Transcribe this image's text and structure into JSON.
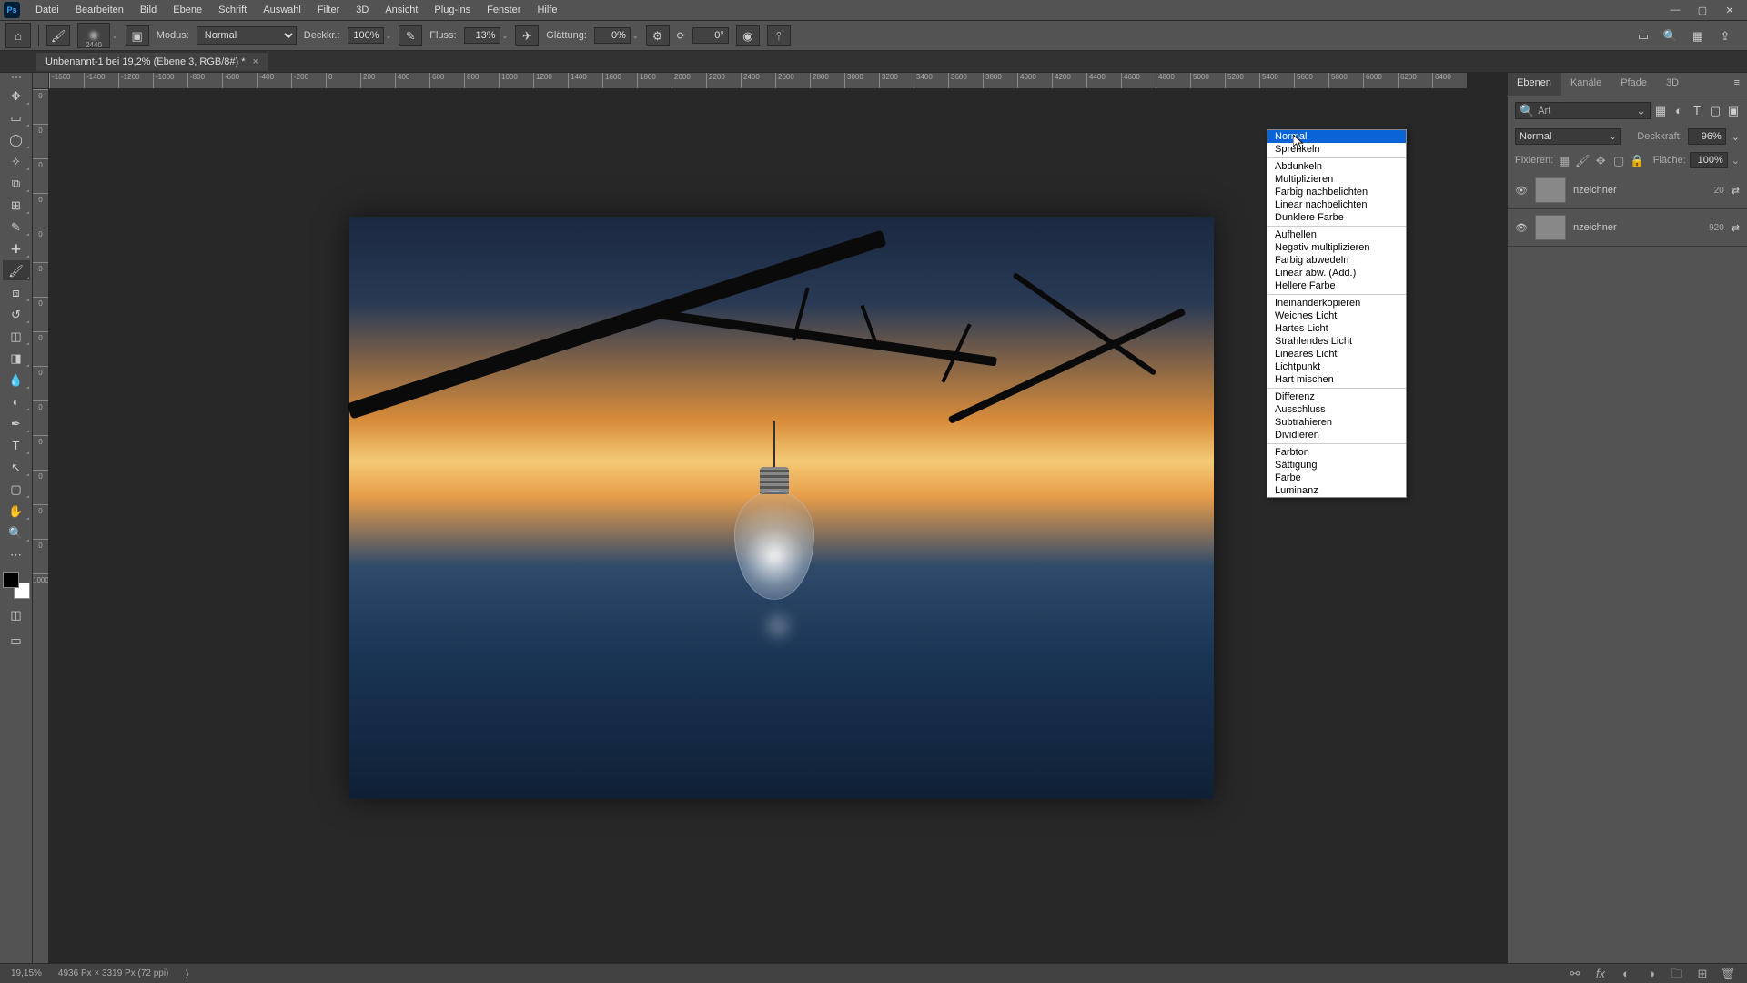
{
  "app": {
    "ps_badge": "Ps"
  },
  "menubar": [
    "Datei",
    "Bearbeiten",
    "Bild",
    "Ebene",
    "Schrift",
    "Auswahl",
    "Filter",
    "3D",
    "Ansicht",
    "Plug-ins",
    "Fenster",
    "Hilfe"
  ],
  "options": {
    "brush_size": "2440",
    "modus_label": "Modus:",
    "modus_value": "Normal",
    "deckkr_label": "Deckkr.:",
    "deckkr_value": "100%",
    "fluss_label": "Fluss:",
    "fluss_value": "13%",
    "glaettung_label": "Glättung:",
    "glaettung_value": "0%",
    "angle_label": "⟳",
    "angle_value": "0°"
  },
  "doc_tab": {
    "title": "Unbenannt-1 bei 19,2% (Ebene 3, RGB/8#) *"
  },
  "ruler_h": [
    "-1600",
    "-1400",
    "-1200",
    "-1000",
    "-800",
    "-600",
    "-400",
    "-200",
    "0",
    "200",
    "400",
    "600",
    "800",
    "1000",
    "1200",
    "1400",
    "1600",
    "1800",
    "2000",
    "2200",
    "2400",
    "2600",
    "2800",
    "3000",
    "3200",
    "3400",
    "3600",
    "3800",
    "4000",
    "4200",
    "4400",
    "4600",
    "4800",
    "5000",
    "5200",
    "5400",
    "5600",
    "5800",
    "6000",
    "6200",
    "6400"
  ],
  "ruler_v": [
    "0",
    "0",
    "0",
    "0",
    "0",
    "0",
    "0",
    "0",
    "0",
    "0",
    "0",
    "0",
    "0",
    "0",
    "1000"
  ],
  "panels": {
    "tabs": [
      "Ebenen",
      "Kanäle",
      "Pfade",
      "3D"
    ],
    "search_label": "Art",
    "blend": {
      "current": "Normal",
      "deckkr_label": "Deckkraft:",
      "deckkr_value": "96%",
      "flaeche_label": "Fläche:",
      "flaeche_value": "100%"
    },
    "lock_label": "Fixieren:",
    "layers": [
      {
        "name": "nzeichner",
        "val": "20"
      },
      {
        "name": "nzeichner",
        "val": "920"
      }
    ]
  },
  "blend_modes": {
    "groups": [
      [
        "Normal",
        "Sprenkeln"
      ],
      [
        "Abdunkeln",
        "Multiplizieren",
        "Farbig nachbelichten",
        "Linear nachbelichten",
        "Dunklere Farbe"
      ],
      [
        "Aufhellen",
        "Negativ multiplizieren",
        "Farbig abwedeln",
        "Linear abw. (Add.)",
        "Hellere Farbe"
      ],
      [
        "Ineinanderkopieren",
        "Weiches Licht",
        "Hartes Licht",
        "Strahlendes Licht",
        "Lineares Licht",
        "Lichtpunkt",
        "Hart mischen"
      ],
      [
        "Differenz",
        "Ausschluss",
        "Subtrahieren",
        "Dividieren"
      ],
      [
        "Farbton",
        "Sättigung",
        "Farbe",
        "Luminanz"
      ]
    ],
    "selected": "Normal"
  },
  "statusbar": {
    "zoom": "19,15%",
    "dims": "4936 Px × 3319 Px (72 ppi)"
  }
}
